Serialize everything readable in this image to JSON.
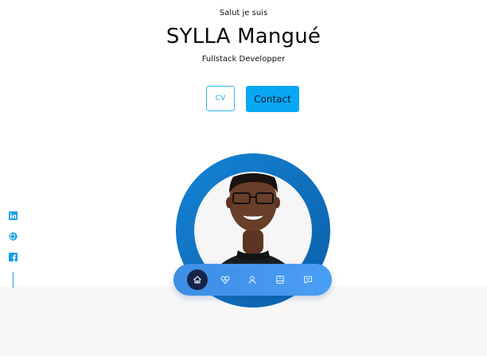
{
  "hero": {
    "greeting": "Salut je suis",
    "name": "SYLLA Mangué",
    "role": "Fullstack Developper"
  },
  "buttons": {
    "cv_label": "CV",
    "contact_label": "Contact"
  },
  "social": [
    {
      "icon": "linkedin-icon"
    },
    {
      "icon": "github-icon"
    },
    {
      "icon": "facebook-icon"
    }
  ],
  "nav": {
    "items": [
      {
        "icon": "home-icon",
        "active": true
      },
      {
        "icon": "services-icon",
        "active": false
      },
      {
        "icon": "user-icon",
        "active": false
      },
      {
        "icon": "portfolio-icon",
        "active": false
      },
      {
        "icon": "message-icon",
        "active": false
      }
    ]
  },
  "colors": {
    "accent": "#08a8f5",
    "ring": "#1479c4",
    "nav": "#3d8ee6",
    "nav_active": "#16244a"
  }
}
